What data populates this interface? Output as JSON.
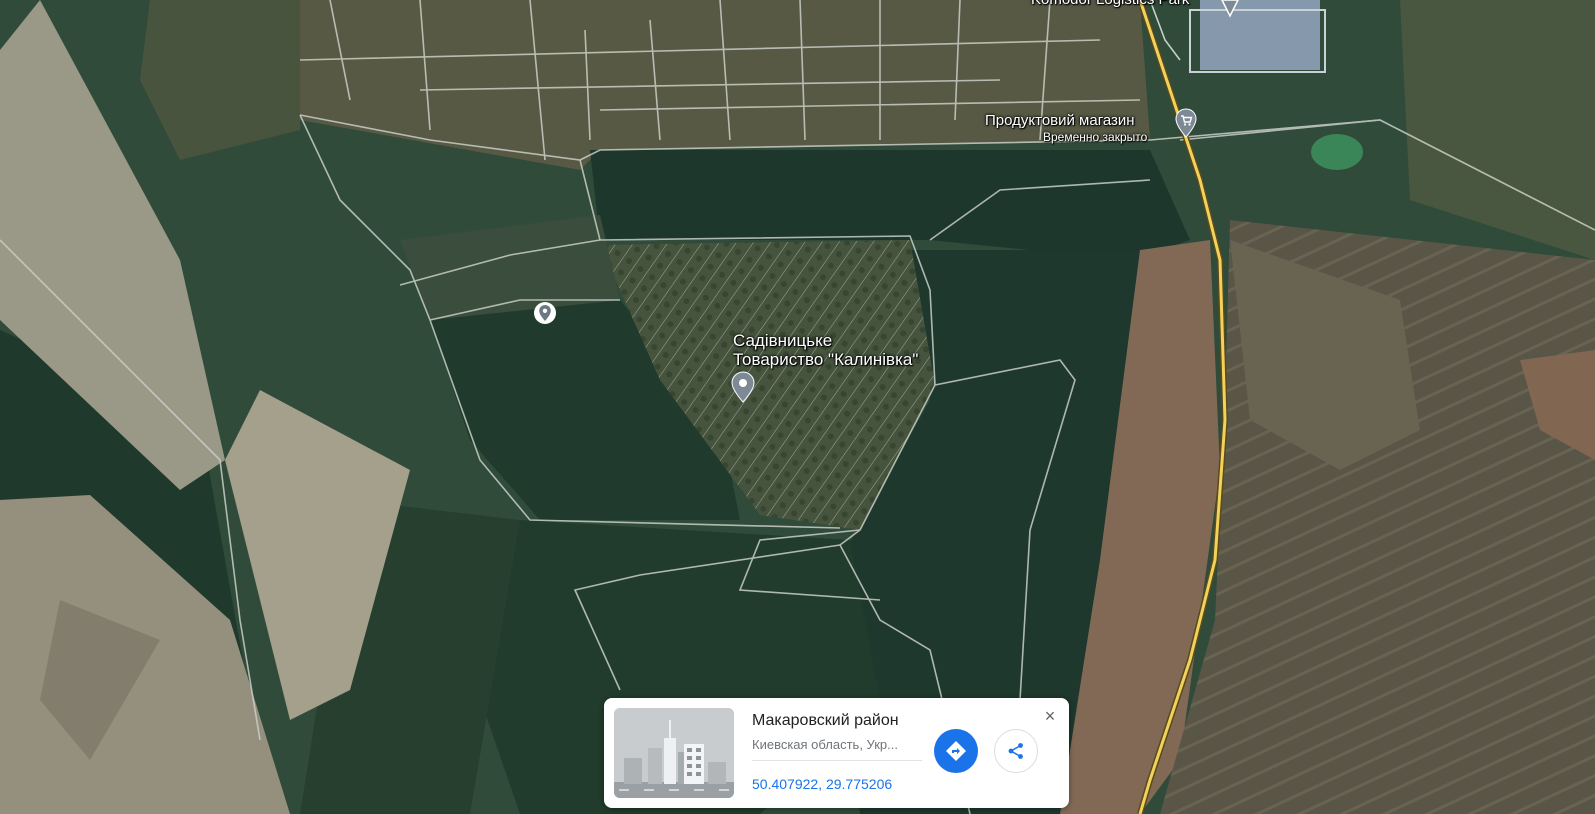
{
  "map": {
    "view": "satellite",
    "colors": {
      "highway": "#f2d25a",
      "road": "#c9cfc6"
    }
  },
  "pois": {
    "logistics_park": "Komodor Logistics Park",
    "shop_name": "Продуктовий магазин",
    "shop_status": "Временно закрыто",
    "garden_name_1": "Садівницьке",
    "garden_name_2": "Товариство \"Калинівка\""
  },
  "card": {
    "title": "Макаровский район",
    "subtitle": "Киевская область, Укр...",
    "coordinates": "50.407922, 29.775206",
    "close_icon": "×",
    "accent": "#1a73e8"
  }
}
